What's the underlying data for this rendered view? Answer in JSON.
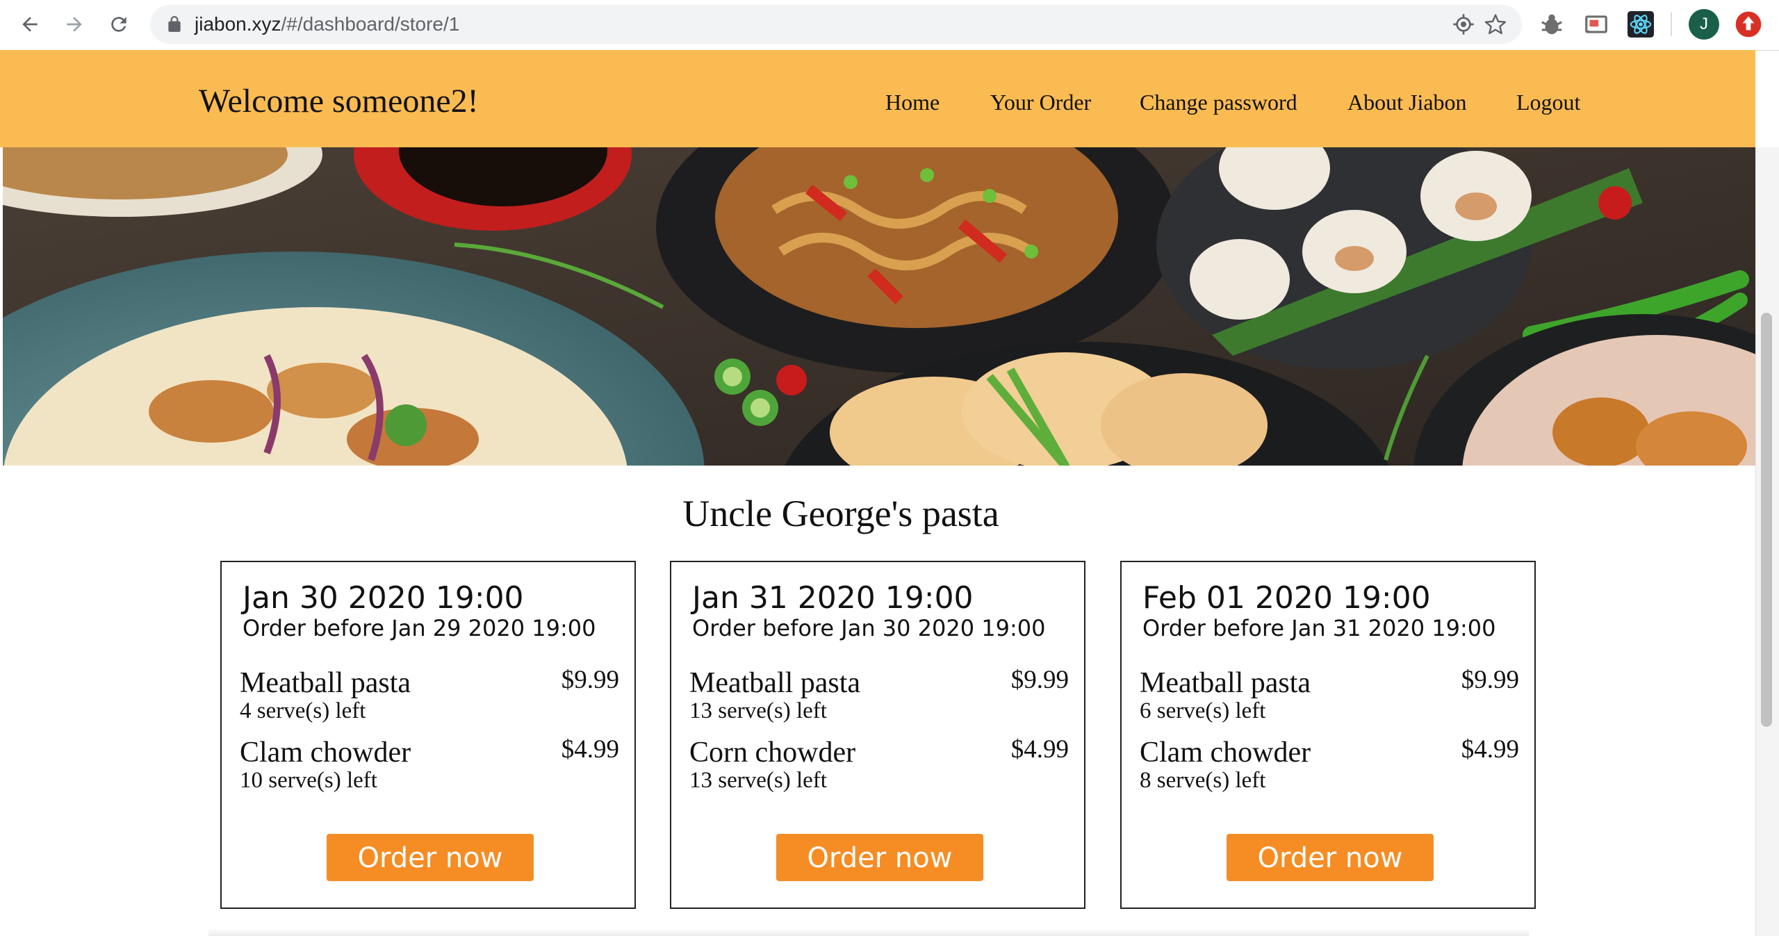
{
  "browser": {
    "url_host": "jiabon.xyz",
    "url_path": "/#/dashboard/store/1",
    "avatar_letter": "J",
    "icons": [
      "back-arrow-icon",
      "forward-arrow-icon",
      "reload-icon",
      "lock-icon",
      "location-target-icon",
      "bookmark-star-icon",
      "bug-extension-icon",
      "cast-extension-icon",
      "react-devtools-icon",
      "update-alert-icon"
    ]
  },
  "header": {
    "welcome": "Welcome someone2!",
    "nav": [
      "Home",
      "Your Order",
      "Change password",
      "About Jiabon",
      "Logout"
    ]
  },
  "store": {
    "name": "Uncle George's pasta",
    "cards": [
      {
        "date": "Jan 30 2020 19:00",
        "deadline": "Order before Jan 29 2020 19:00",
        "items": [
          {
            "name": "Meatball pasta",
            "left": "4 serve(s) left",
            "price": "$9.99"
          },
          {
            "name": "Clam chowder",
            "left": "10 serve(s) left",
            "price": "$4.99"
          }
        ],
        "button": "Order now"
      },
      {
        "date": "Jan 31 2020 19:00",
        "deadline": "Order before Jan 30 2020 19:00",
        "items": [
          {
            "name": "Meatball pasta",
            "left": "13 serve(s) left",
            "price": "$9.99"
          },
          {
            "name": "Corn chowder",
            "left": "13 serve(s) left",
            "price": "$4.99"
          }
        ],
        "button": "Order now"
      },
      {
        "date": "Feb 01 2020 19:00",
        "deadline": "Order before Jan 31 2020 19:00",
        "items": [
          {
            "name": "Meatball pasta",
            "left": "6 serve(s) left",
            "price": "$9.99"
          },
          {
            "name": "Clam chowder",
            "left": "8 serve(s) left",
            "price": "$4.99"
          }
        ],
        "button": "Order now"
      }
    ]
  },
  "colors": {
    "header_bg": "#fbbb53",
    "button_bg": "#f58d24",
    "button_text": "#ffffff"
  }
}
